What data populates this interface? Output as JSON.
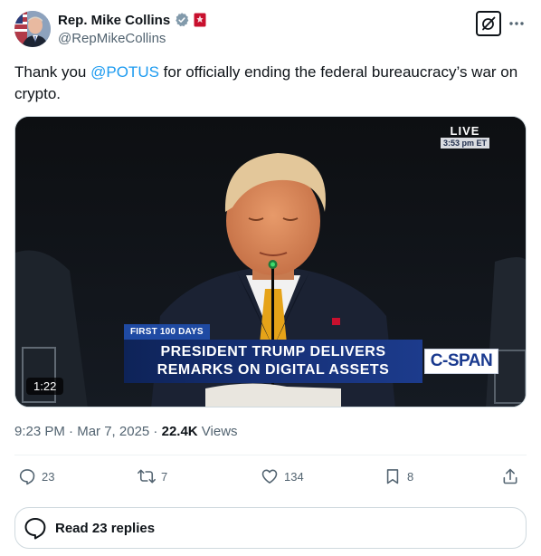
{
  "author": {
    "name": "Rep. Mike Collins",
    "handle": "@RepMikeCollins"
  },
  "tweet": {
    "text_before": "Thank you ",
    "mention": "@POTUS",
    "text_after": " for officially ending the federal bureaucracy’s war on crypto."
  },
  "video": {
    "live_label": "LIVE",
    "live_time": "3:53 pm ET",
    "tag": "FIRST 100 DAYS",
    "headline_line1": "PRESIDENT TRUMP DELIVERS",
    "headline_line2": "REMARKS ON DIGITAL ASSETS",
    "network": "C-SPAN",
    "duration": "1:22"
  },
  "meta": {
    "time": "9:23 PM",
    "sep1": " · ",
    "date": "Mar 7, 2025",
    "sep2": " · ",
    "views_count": "22.4K",
    "views_label": " Views"
  },
  "actions": {
    "replies": "23",
    "reposts": "7",
    "likes": "134",
    "bookmarks": "8"
  },
  "read_replies": "Read 23 replies",
  "colors": {
    "accent": "#1d9bf0",
    "text": "#0f1419",
    "muted": "#536471",
    "verified_badge": "#829aab",
    "affiliate_badge": "#c8102e"
  }
}
